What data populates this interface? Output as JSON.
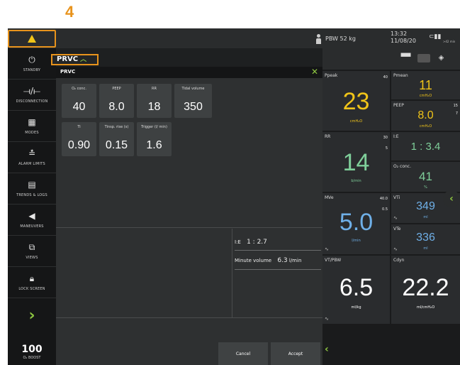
{
  "step_label": "4",
  "topbar": {
    "pbw": "PBW 52 kg",
    "time": "13:32",
    "date": "11/08/20",
    "battery_sub": ">42 min"
  },
  "sidebar": {
    "items": [
      {
        "label": "STANDBY",
        "icon": "power-icon"
      },
      {
        "label": "DISCONNECTION",
        "icon": "disconnection-icon"
      },
      {
        "label": "MODES",
        "icon": "grid-icon"
      },
      {
        "label": "ALARM LIMITS",
        "icon": "alarm-limits-icon"
      },
      {
        "label": "TRENDS & LOGS",
        "icon": "trends-icon"
      },
      {
        "label": "MANEUVERS",
        "icon": "maneuvers-icon"
      },
      {
        "label": "VIEWS",
        "icon": "views-icon"
      },
      {
        "label": "LOCK SCREEN",
        "icon": "lock-icon"
      }
    ],
    "o2_boost_value": "100",
    "o2_boost_label": "O₂ BOOST"
  },
  "mode_tab": {
    "label": "PRVC"
  },
  "dialog": {
    "title": "PRVC",
    "params_row1": [
      {
        "label": "O₂ conc.",
        "value": "40"
      },
      {
        "label": "PEEP",
        "value": "8.0"
      },
      {
        "label": "RR",
        "value": "18"
      },
      {
        "label": "Tidal volume",
        "value": "350"
      }
    ],
    "params_row2": [
      {
        "label": "Ti",
        "value": "0.90"
      },
      {
        "label": "Tinsp. rise (s)",
        "value": "0.15"
      },
      {
        "label": "Trigger (l/ min)",
        "value": "1.6"
      }
    ],
    "ie_label": "I:E",
    "ie_value": "1 : 2.7",
    "mv_label": "Minute volume",
    "mv_value": "6.3",
    "mv_unit": "l/min",
    "cancel_label": "Cancel",
    "accept_label": "Accept"
  },
  "metrics": {
    "ppeak": {
      "name": "Ppeak",
      "limit": "40",
      "value": "23",
      "unit": "cmH₂O"
    },
    "pmean": {
      "name": "Pmean",
      "value": "11",
      "unit": "cmH₂O"
    },
    "peep": {
      "name": "PEEP",
      "limit_hi": "15",
      "limit_lo": "7",
      "value": "8.0",
      "unit": "cmH₂O"
    },
    "rr": {
      "name": "RR",
      "limit_hi": "30",
      "limit_lo": "5",
      "value": "14",
      "unit": "b/min"
    },
    "ie": {
      "name": "I:E",
      "value": "1 : 3.4"
    },
    "o2": {
      "name": "O₂ conc.",
      "value": "41",
      "unit": "%"
    },
    "mve": {
      "name": "MVe",
      "limit_hi": "40.0",
      "limit_lo": "0.5",
      "value": "5.0",
      "unit": "l/min"
    },
    "vti": {
      "name": "VTi",
      "value": "349",
      "unit": "ml"
    },
    "vte": {
      "name": "VTe",
      "value": "336",
      "unit": "ml"
    },
    "vtpbw": {
      "name": "VT/PBW",
      "value": "6.5",
      "unit": "ml/kg"
    },
    "cdyn": {
      "name": "Cdyn",
      "value": "22.2",
      "unit": "ml/cmH₂O"
    }
  },
  "colors": {
    "highlight": "#e8931c",
    "pressure": "#f0c419",
    "flow": "#7fcf9a",
    "volume": "#6fb0e8",
    "accent_green": "#8ec641"
  }
}
